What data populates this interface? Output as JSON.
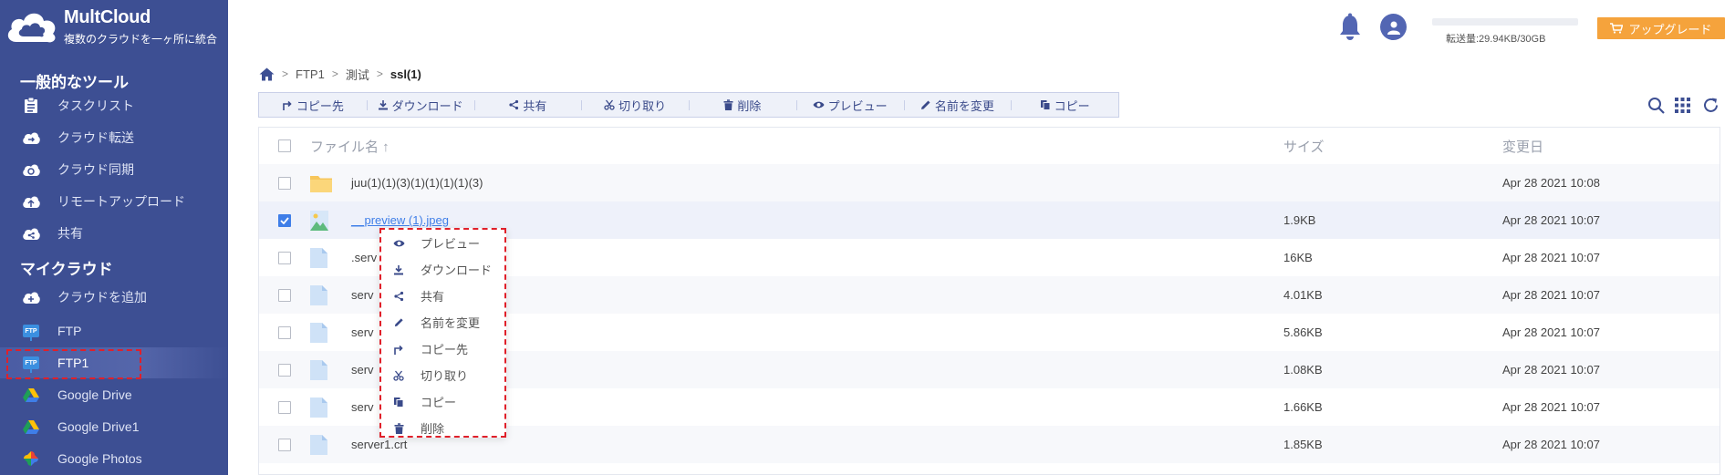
{
  "app": {
    "name": "MultCloud",
    "tagline": "複数のクラウドを一ヶ所に統合"
  },
  "sidebar": {
    "tools_title": "一般的なツール",
    "tools": [
      {
        "label": "タスクリスト",
        "icon": "task-list-icon"
      },
      {
        "label": "クラウド転送",
        "icon": "cloud-transfer-icon"
      },
      {
        "label": "クラウド同期",
        "icon": "cloud-sync-icon"
      },
      {
        "label": "リモートアップロード",
        "icon": "remote-upload-icon"
      },
      {
        "label": "共有",
        "icon": "share-cloud-icon"
      }
    ],
    "mycloud_title": "マイクラウド",
    "clouds": [
      {
        "label": "クラウドを追加",
        "icon": "add-cloud-icon"
      },
      {
        "label": "FTP",
        "icon": "ftp-icon"
      },
      {
        "label": "FTP1",
        "icon": "ftp-icon"
      },
      {
        "label": "Google Drive",
        "icon": "google-drive-icon"
      },
      {
        "label": "Google Drive1",
        "icon": "google-drive-icon"
      },
      {
        "label": "Google Photos",
        "icon": "google-photos-icon"
      }
    ],
    "ftp_badge": "FTP"
  },
  "header": {
    "quota_text": "転送量:29.94KB/30GB",
    "upgrade_label": "アップグレード"
  },
  "breadcrumb": {
    "items": [
      "FTP1",
      "測试"
    ],
    "current": "ssl(1)"
  },
  "toolbar": {
    "copy_to": "コピー先",
    "download": "ダウンロード",
    "share": "共有",
    "cut": "切り取り",
    "delete": "削除",
    "preview": "プレビュー",
    "rename": "名前を変更",
    "copy": "コピー"
  },
  "table": {
    "headers": {
      "name": "ファイル名 ↑",
      "size": "サイズ",
      "modified": "変更日"
    },
    "rows": [
      {
        "name": "juu(1)(1)(3)(1)(1)(1)(1)(3)",
        "size": "",
        "modified": "Apr 28 2021 10:08",
        "type": "folder",
        "checked": false
      },
      {
        "name": "__preview (1).jpeg",
        "size": "1.9KB",
        "modified": "Apr 28 2021 10:07",
        "type": "image",
        "checked": true
      },
      {
        "name": ".serv",
        "size": "16KB",
        "modified": "Apr 28 2021 10:07",
        "type": "file",
        "checked": false
      },
      {
        "name": "serv",
        "size": "4.01KB",
        "modified": "Apr 28 2021 10:07",
        "type": "file",
        "checked": false
      },
      {
        "name": "serv",
        "size": "5.86KB",
        "modified": "Apr 28 2021 10:07",
        "type": "file",
        "checked": false
      },
      {
        "name": "serv",
        "size": "1.08KB",
        "modified": "Apr 28 2021 10:07",
        "type": "file",
        "checked": false
      },
      {
        "name": "serv",
        "size": "1.66KB",
        "modified": "Apr 28 2021 10:07",
        "type": "file",
        "checked": false
      },
      {
        "name": "server1.crt",
        "size": "1.85KB",
        "modified": "Apr 28 2021 10:07",
        "type": "file",
        "checked": false
      }
    ]
  },
  "context_menu": {
    "items": [
      {
        "label": "プレビュー",
        "icon": "eye-icon"
      },
      {
        "label": "ダウンロード",
        "icon": "download-icon"
      },
      {
        "label": "共有",
        "icon": "share-icon"
      },
      {
        "label": "名前を変更",
        "icon": "pencil-icon"
      },
      {
        "label": "コピー先",
        "icon": "copy-to-icon"
      },
      {
        "label": "切り取り",
        "icon": "scissors-icon"
      },
      {
        "label": "コピー",
        "icon": "copy-icon"
      },
      {
        "label": "削除",
        "icon": "trash-icon"
      }
    ]
  },
  "colors": {
    "sidebar": "#3d4f93",
    "accent": "#3f7ee8",
    "upgrade": "#f5a33c",
    "highlight": "#e0202a"
  }
}
